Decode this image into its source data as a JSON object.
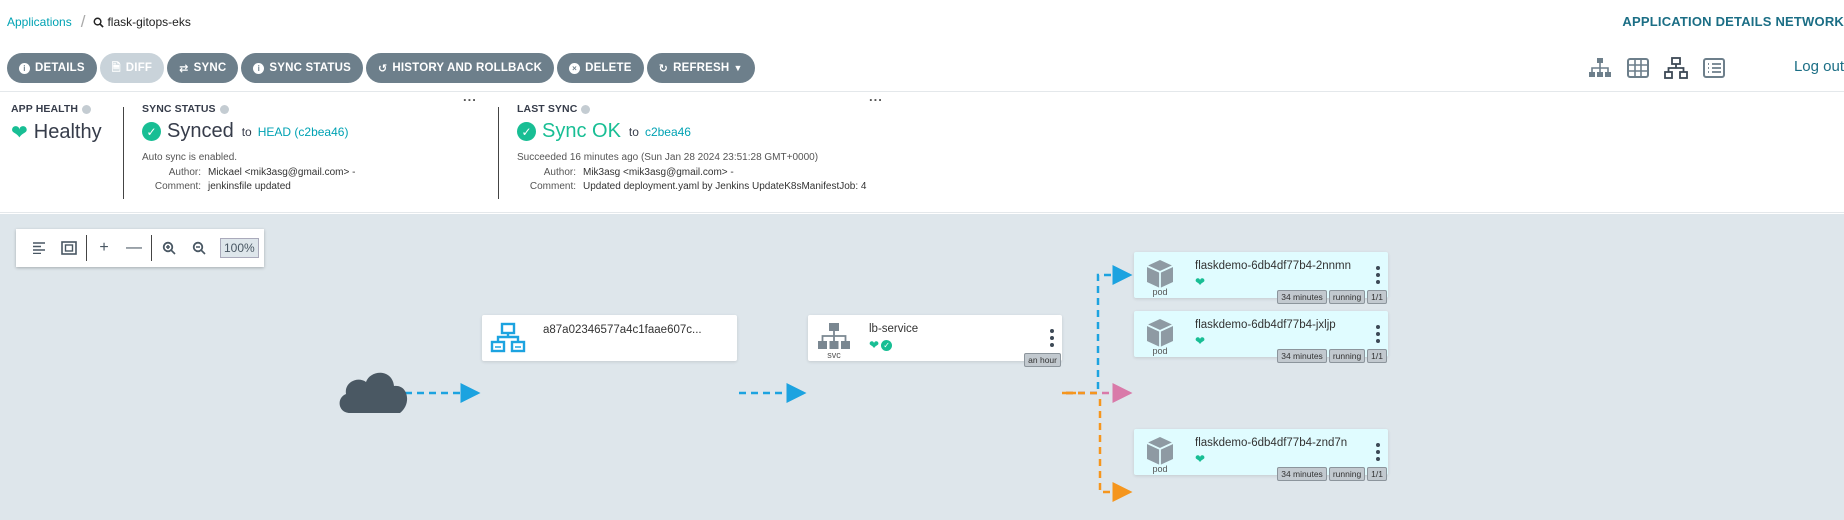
{
  "breadcrumb": {
    "root": "Applications",
    "current": "flask-gitops-eks"
  },
  "page_heading": "APPLICATION DETAILS NETWORK",
  "toolbar": {
    "buttons": [
      {
        "label": "DETAILS",
        "icon": "info-icon"
      },
      {
        "label": "DIFF",
        "icon": "file-icon"
      },
      {
        "label": "SYNC",
        "icon": "sync-icon"
      },
      {
        "label": "SYNC STATUS",
        "icon": "info-icon"
      },
      {
        "label": "HISTORY AND ROLLBACK",
        "icon": "history-icon"
      },
      {
        "label": "DELETE",
        "icon": "x-circle-icon"
      },
      {
        "label": "REFRESH",
        "icon": "refresh-icon"
      }
    ],
    "logout": "Log out"
  },
  "status": {
    "app_health": {
      "title": "APP HEALTH",
      "value": "Healthy"
    },
    "sync_status": {
      "title": "SYNC STATUS",
      "value": "Synced",
      "to": "to",
      "revision": "HEAD (c2bea46)",
      "auto_sync": "Auto sync is enabled.",
      "author_label": "Author:",
      "author": "Mickael <mik3asg@gmail.com> -",
      "comment_label": "Comment:",
      "comment": "jenkinsfile updated"
    },
    "last_sync": {
      "title": "LAST SYNC",
      "value": "Sync OK",
      "to": "to",
      "revision": "c2bea46",
      "succeeded": "Succeeded 16 minutes ago (Sun Jan 28 2024 23:51:28 GMT+0000)",
      "author_label": "Author:",
      "author": "Mik3asg <mik3asg@gmail.com> -",
      "comment_label": "Comment:",
      "comment": "Updated deployment.yaml by Jenkins UpdateK8sManifestJob: 4"
    }
  },
  "zoom": {
    "level": "100%"
  },
  "graph": {
    "lb_node": {
      "name": "a87a02346577a4c1faae607c..."
    },
    "service_node": {
      "name": "lb-service",
      "kind": "svc",
      "age": "an hour"
    },
    "pods": [
      {
        "name": "flaskdemo-6db4df77b4-2nnmn",
        "kind": "pod",
        "age": "34 minutes",
        "status": "running",
        "ready": "1/1"
      },
      {
        "name": "flaskdemo-6db4df77b4-jxljp",
        "kind": "pod",
        "age": "34 minutes",
        "status": "running",
        "ready": "1/1"
      },
      {
        "name": "flaskdemo-6db4df77b4-znd7n",
        "kind": "pod",
        "age": "34 minutes",
        "status": "running",
        "ready": "1/1"
      }
    ],
    "colors": {
      "edge_blue": "#1ca3e0",
      "edge_pink": "#d97aa9",
      "edge_orange": "#f5961e",
      "health": "#18be94"
    }
  }
}
